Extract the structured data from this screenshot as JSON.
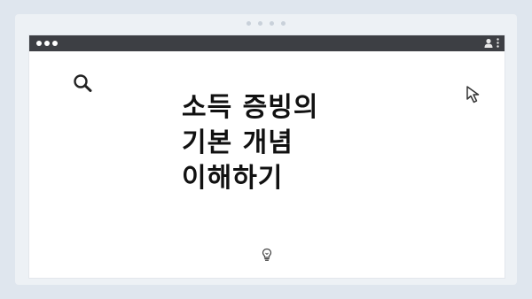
{
  "page": {
    "title_lines": [
      "소득 증빙의",
      "기본 개념",
      "이해하기"
    ]
  },
  "icons": {
    "search": "search-icon",
    "cursor": "cursor-arrow-icon",
    "bulb": "lightbulb-icon",
    "user": "user-icon",
    "more": "more-vertical-icon"
  },
  "colors": {
    "titlebar": "#3d3f44",
    "background": "#dfe6ee",
    "frame": "#edf1f5",
    "window": "#ffffff",
    "text": "#111111"
  }
}
